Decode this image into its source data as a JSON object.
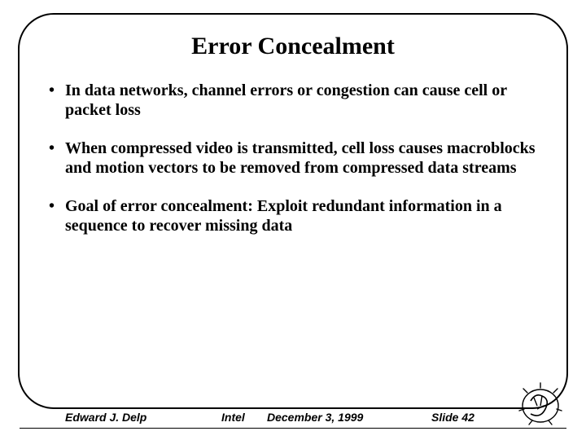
{
  "title": "Error Concealment",
  "bullets": [
    "In data networks, channel errors or congestion can cause cell or packet loss",
    "When compressed video is transmitted, cell loss causes macroblocks and motion vectors to be removed from compressed data streams",
    "Goal of error concealment: Exploit redundant information in a sequence to recover missing data"
  ],
  "footer": {
    "author": "Edward J. Delp",
    "org": "Intel",
    "date": "December 3, 1999",
    "slide": "Slide 42"
  }
}
